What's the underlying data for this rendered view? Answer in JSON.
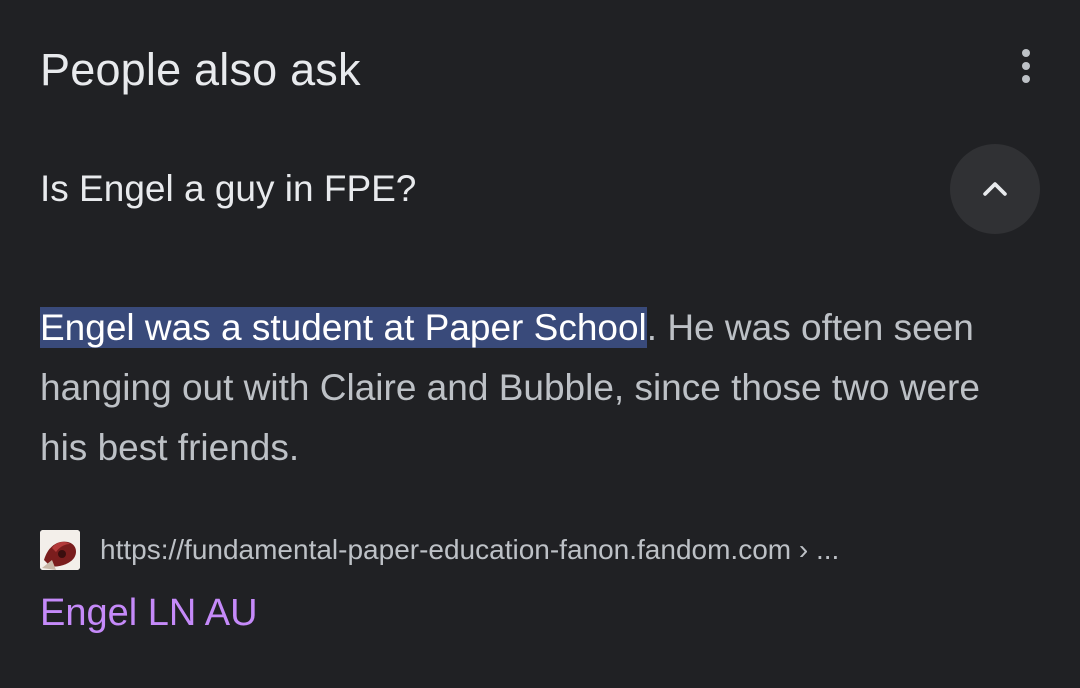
{
  "section": {
    "title": "People also ask",
    "more_icon": "more-vert-icon"
  },
  "question": {
    "text": "Is Engel a guy in FPE?",
    "toggle_icon": "chevron-up-icon"
  },
  "answer": {
    "highlighted": "Engel was a student at Paper School",
    "rest": ". He was often seen hanging out with Claire and Bubble, since those two were his best friends."
  },
  "source": {
    "favicon_icon": "site-favicon-icon",
    "url": "https://fundamental-paper-education-fanon.fandom.com",
    "breadcrumb": " › ..."
  },
  "result": {
    "title": "Engel LN AU"
  },
  "colors": {
    "background": "#202124",
    "highlight": "#394a7a",
    "link": "#c58af9",
    "text_primary": "#e8eaed",
    "text_secondary": "#bdc1c6"
  }
}
